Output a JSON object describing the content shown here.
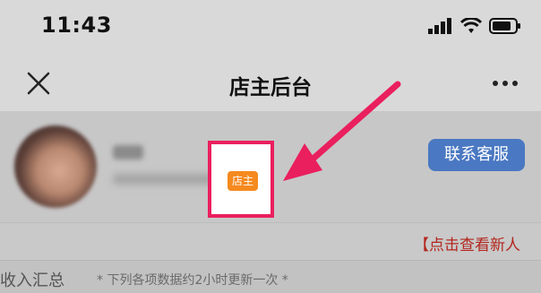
{
  "status_bar": {
    "time": "11:43"
  },
  "nav": {
    "title": "店主后台",
    "close_icon": "close-icon",
    "more_icon": "more-icon"
  },
  "profile": {
    "badge": "店主",
    "service_button": "联系客服"
  },
  "notice": {
    "link_text": "【点击查看新人"
  },
  "summary": {
    "title": "收入汇总",
    "note": "* 下列各项数据约2小时更新一次 *"
  },
  "colors": {
    "highlight": "#ea1f5e",
    "arrow": "#ea1f5e",
    "badge": "#f58a1f",
    "service_button": "#4a78c2",
    "notice": "#b3261e"
  }
}
